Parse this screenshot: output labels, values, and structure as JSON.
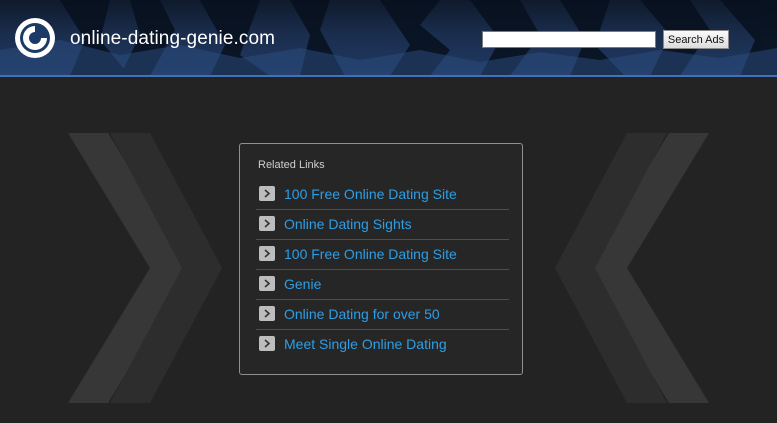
{
  "header": {
    "site_name": "online-dating-genie.com",
    "search_button_label": "Search Ads",
    "search_value": ""
  },
  "related_links": {
    "title": "Related Links",
    "items": [
      {
        "label": "100 Free Online Dating Site"
      },
      {
        "label": "Online Dating Sights"
      },
      {
        "label": "100 Free Online Dating Site"
      },
      {
        "label": "Genie"
      },
      {
        "label": "Online Dating for over 50"
      },
      {
        "label": "Meet Single Online Dating"
      }
    ]
  },
  "colors": {
    "link": "#2d9ee6",
    "header_accent": "#3f72b8",
    "background": "#232323"
  },
  "icons": {
    "logo": "circular-logo-icon",
    "link_bullet": "chevron-right-icon"
  }
}
